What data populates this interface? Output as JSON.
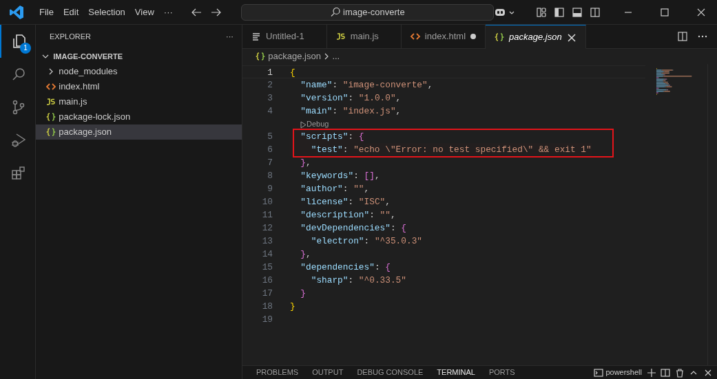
{
  "title_bar": {
    "menu": [
      "File",
      "Edit",
      "Selection",
      "View",
      "···"
    ],
    "search": {
      "value": "image-converte"
    }
  },
  "activity_bar": [
    {
      "kind": "explorer",
      "selected": true,
      "badge": "1"
    },
    {
      "kind": "search",
      "selected": false
    },
    {
      "kind": "source-control",
      "selected": false
    },
    {
      "kind": "run-debug",
      "selected": false
    },
    {
      "kind": "extensions",
      "selected": false
    }
  ],
  "sidebar": {
    "title": "EXPLORER",
    "more": "···",
    "root": {
      "label": "IMAGE-CONVERTE",
      "expanded": true,
      "children": [
        {
          "label": "node_modules",
          "kind": "folder",
          "expanded": false,
          "selected": false
        },
        {
          "label": "index.html",
          "kind": "html",
          "selected": false
        },
        {
          "label": "main.js",
          "kind": "js",
          "selected": false
        },
        {
          "label": "package-lock.json",
          "kind": "json",
          "selected": false
        },
        {
          "label": "package.json",
          "kind": "json",
          "selected": true
        }
      ]
    }
  },
  "tabs": [
    {
      "label": "Untitled-1",
      "kind": "text",
      "selected": false,
      "modified": false,
      "preview": false
    },
    {
      "label": "main.js",
      "kind": "js",
      "selected": false,
      "modified": false,
      "preview": false
    },
    {
      "label": "index.html",
      "kind": "html",
      "selected": false,
      "modified": true,
      "preview": false
    },
    {
      "label": "package.json",
      "kind": "json",
      "selected": true,
      "modified": false,
      "preview": true
    }
  ],
  "breadcrumb": [
    "package.json",
    "..."
  ],
  "editor": {
    "lines": [
      {
        "kind": "code",
        "number": "1",
        "selected": true,
        "highlighted": false,
        "tokens": [
          {
            "kind": "brace1",
            "text": "{"
          }
        ]
      },
      {
        "kind": "code",
        "number": "2",
        "selected": false,
        "highlighted": false,
        "tokens": [
          {
            "kind": "key",
            "text": "  \"name\""
          },
          {
            "kind": "plain",
            "text": ": "
          },
          {
            "kind": "string",
            "text": "\"image-converte\""
          },
          {
            "kind": "plain",
            "text": ","
          }
        ]
      },
      {
        "kind": "code",
        "number": "3",
        "selected": false,
        "highlighted": false,
        "tokens": [
          {
            "kind": "key",
            "text": "  \"version\""
          },
          {
            "kind": "plain",
            "text": ": "
          },
          {
            "kind": "string",
            "text": "\"1.0.0\""
          },
          {
            "kind": "plain",
            "text": ","
          }
        ]
      },
      {
        "kind": "code",
        "number": "4",
        "selected": false,
        "highlighted": false,
        "tokens": [
          {
            "kind": "key",
            "text": "  \"main\""
          },
          {
            "kind": "plain",
            "text": ": "
          },
          {
            "kind": "string",
            "text": "\"index.js\""
          },
          {
            "kind": "plain",
            "text": ","
          }
        ]
      },
      {
        "kind": "codelens",
        "text": "Debug"
      },
      {
        "kind": "code",
        "number": "5",
        "selected": false,
        "highlighted": true,
        "tokens": [
          {
            "kind": "key",
            "text": "  \"scripts\""
          },
          {
            "kind": "plain",
            "text": ": "
          },
          {
            "kind": "brace2",
            "text": "{"
          }
        ]
      },
      {
        "kind": "code",
        "number": "6",
        "selected": false,
        "highlighted": true,
        "tokens": [
          {
            "kind": "key",
            "text": "    \"test\""
          },
          {
            "kind": "plain",
            "text": ": "
          },
          {
            "kind": "string",
            "text": "\"echo \\\"Error: no test specified\\\" && exit 1\""
          }
        ]
      },
      {
        "kind": "code",
        "number": "7",
        "selected": false,
        "highlighted": false,
        "tokens": [
          {
            "kind": "brace2",
            "text": "  }"
          },
          {
            "kind": "plain",
            "text": ","
          }
        ]
      },
      {
        "kind": "code",
        "number": "8",
        "selected": false,
        "highlighted": false,
        "tokens": [
          {
            "kind": "key",
            "text": "  \"keywords\""
          },
          {
            "kind": "plain",
            "text": ": "
          },
          {
            "kind": "brace2",
            "text": "[]"
          },
          {
            "kind": "plain",
            "text": ","
          }
        ]
      },
      {
        "kind": "code",
        "number": "9",
        "selected": false,
        "highlighted": false,
        "tokens": [
          {
            "kind": "key",
            "text": "  \"author\""
          },
          {
            "kind": "plain",
            "text": ": "
          },
          {
            "kind": "string",
            "text": "\"\""
          },
          {
            "kind": "plain",
            "text": ","
          }
        ]
      },
      {
        "kind": "code",
        "number": "10",
        "selected": false,
        "highlighted": false,
        "tokens": [
          {
            "kind": "key",
            "text": "  \"license\""
          },
          {
            "kind": "plain",
            "text": ": "
          },
          {
            "kind": "string",
            "text": "\"ISC\""
          },
          {
            "kind": "plain",
            "text": ","
          }
        ]
      },
      {
        "kind": "code",
        "number": "11",
        "selected": false,
        "highlighted": false,
        "tokens": [
          {
            "kind": "key",
            "text": "  \"description\""
          },
          {
            "kind": "plain",
            "text": ": "
          },
          {
            "kind": "string",
            "text": "\"\""
          },
          {
            "kind": "plain",
            "text": ","
          }
        ]
      },
      {
        "kind": "code",
        "number": "12",
        "selected": false,
        "highlighted": false,
        "tokens": [
          {
            "kind": "key",
            "text": "  \"devDependencies\""
          },
          {
            "kind": "plain",
            "text": ": "
          },
          {
            "kind": "brace2",
            "text": "{"
          }
        ]
      },
      {
        "kind": "code",
        "number": "13",
        "selected": false,
        "highlighted": false,
        "tokens": [
          {
            "kind": "key",
            "text": "    \"electron\""
          },
          {
            "kind": "plain",
            "text": ": "
          },
          {
            "kind": "string",
            "text": "\"^35.0.3\""
          }
        ]
      },
      {
        "kind": "code",
        "number": "14",
        "selected": false,
        "highlighted": false,
        "tokens": [
          {
            "kind": "brace2",
            "text": "  }"
          },
          {
            "kind": "plain",
            "text": ","
          }
        ]
      },
      {
        "kind": "code",
        "number": "15",
        "selected": false,
        "highlighted": false,
        "tokens": [
          {
            "kind": "key",
            "text": "  \"dependencies\""
          },
          {
            "kind": "plain",
            "text": ": "
          },
          {
            "kind": "brace2",
            "text": "{"
          }
        ]
      },
      {
        "kind": "code",
        "number": "16",
        "selected": false,
        "highlighted": false,
        "tokens": [
          {
            "kind": "key",
            "text": "    \"sharp\""
          },
          {
            "kind": "plain",
            "text": ": "
          },
          {
            "kind": "string",
            "text": "\"^0.33.5\""
          }
        ]
      },
      {
        "kind": "code",
        "number": "17",
        "selected": false,
        "highlighted": false,
        "tokens": [
          {
            "kind": "brace2",
            "text": "  }"
          }
        ]
      },
      {
        "kind": "code",
        "number": "18",
        "selected": false,
        "highlighted": false,
        "tokens": [
          {
            "kind": "brace1",
            "text": "}"
          }
        ]
      },
      {
        "kind": "code",
        "number": "19",
        "selected": false
      }
    ]
  },
  "panel": {
    "tabs": [
      {
        "label": "PROBLEMS",
        "selected": false
      },
      {
        "label": "OUTPUT",
        "selected": false
      },
      {
        "label": "DEBUG CONSOLE",
        "selected": false
      },
      {
        "label": "TERMINAL",
        "selected": true
      },
      {
        "label": "PORTS",
        "selected": false
      }
    ],
    "terminal": "powershell"
  }
}
